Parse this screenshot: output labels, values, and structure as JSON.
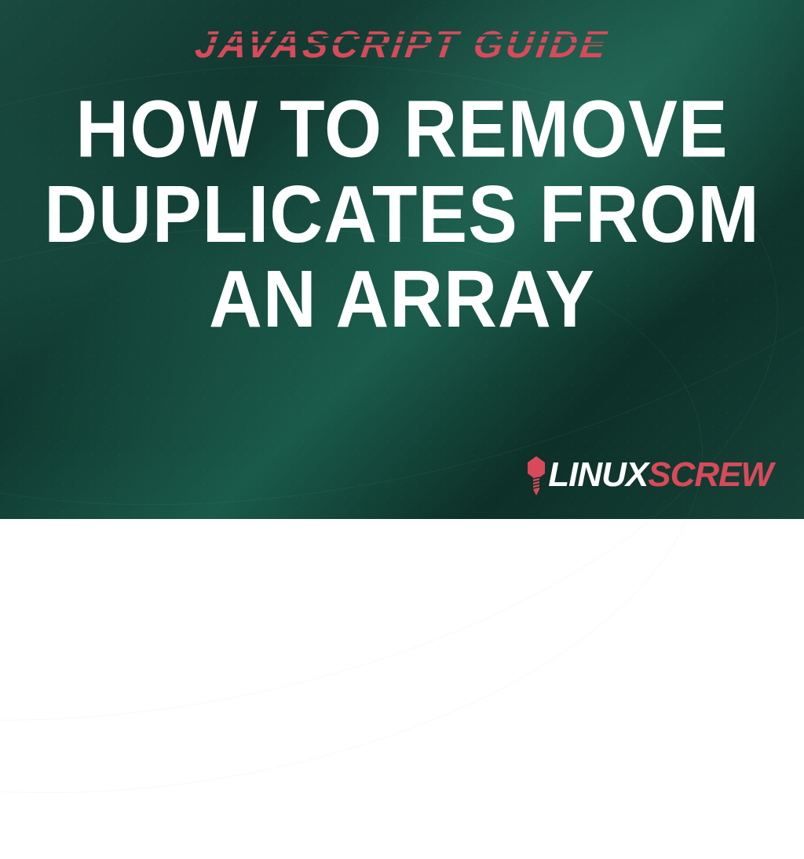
{
  "banner": {
    "subtitle": "JAVASCRIPT GUIDE",
    "title": "HOW TO REMOVE DUPLICATES FROM AN ARRAY"
  },
  "logo": {
    "part1": "LINUX",
    "part2": "SCREW"
  },
  "colors": {
    "accent": "#d84a5a",
    "text": "#ffffff",
    "bg_dark": "#0d3028",
    "bg_mid": "#1a5a4a"
  }
}
